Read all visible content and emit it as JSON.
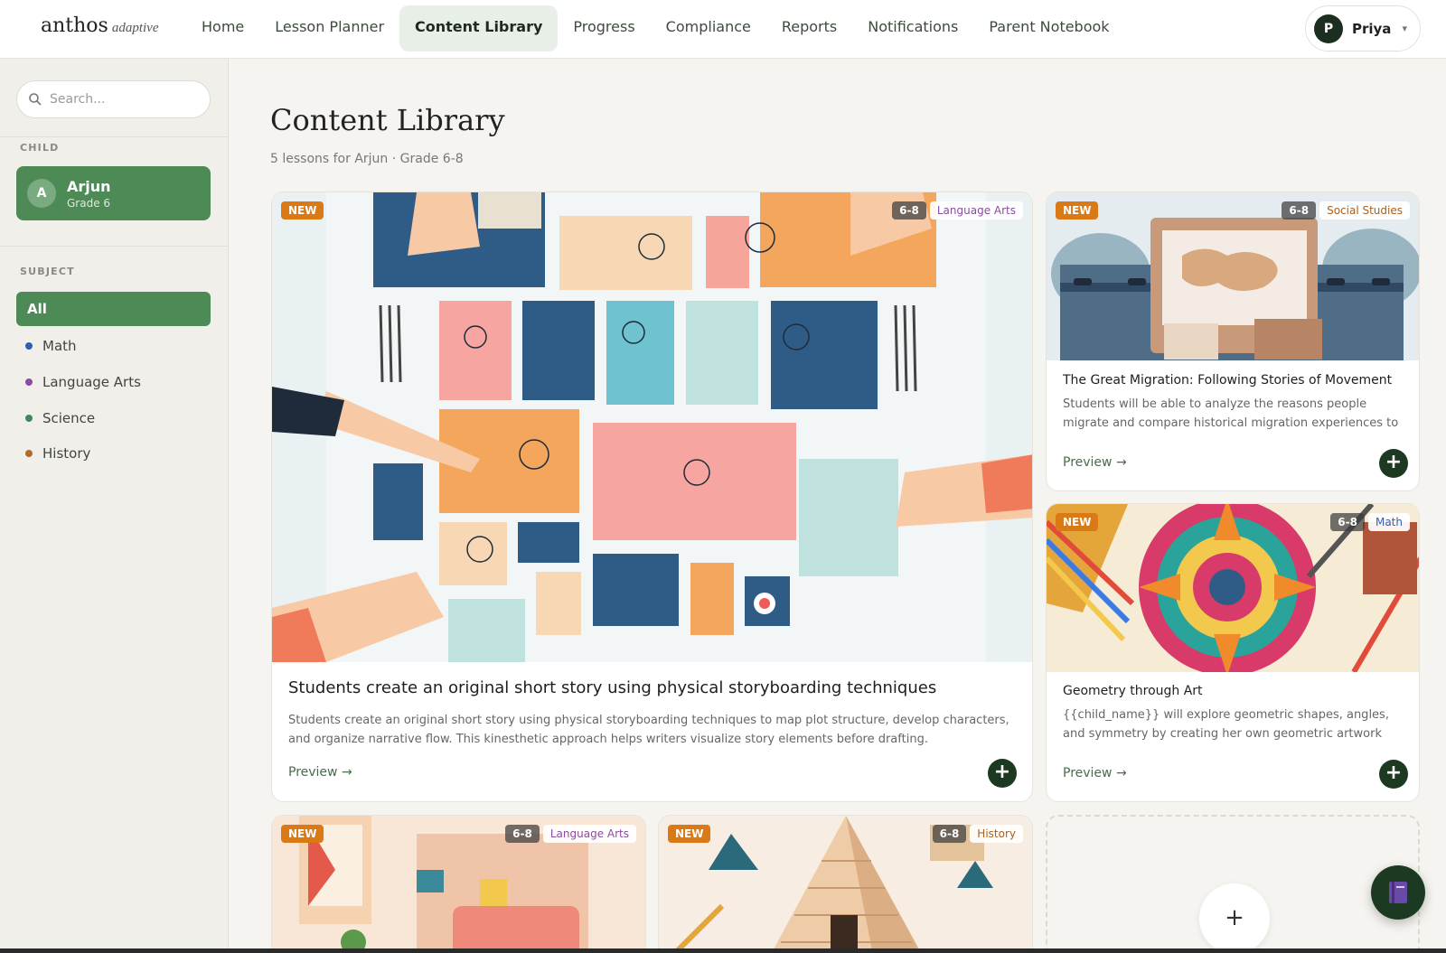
{
  "brand": {
    "name": "anthos",
    "tagline": "adaptive"
  },
  "nav": {
    "items": [
      {
        "label": "Home"
      },
      {
        "label": "Lesson Planner"
      },
      {
        "label": "Content Library",
        "active": true
      },
      {
        "label": "Progress"
      },
      {
        "label": "Compliance"
      },
      {
        "label": "Reports"
      },
      {
        "label": "Notifications"
      },
      {
        "label": "Parent Notebook"
      }
    ]
  },
  "user": {
    "initial": "P",
    "name": "Priya",
    "caret": "▾"
  },
  "sidebar": {
    "search_placeholder": "Search...",
    "child_label": "CHILD",
    "child": {
      "initial": "A",
      "name": "Arjun",
      "grade": "Grade 6"
    },
    "subject_label": "SUBJECT",
    "subjects": [
      {
        "label": "All",
        "active": true
      },
      {
        "label": "Math",
        "color": "#2f5fb3"
      },
      {
        "label": "Language Arts",
        "color": "#8a4c9e"
      },
      {
        "label": "Science",
        "color": "#3f8a5a"
      },
      {
        "label": "History",
        "color": "#b06a2a"
      }
    ]
  },
  "main": {
    "title": "Content Library",
    "subtitle": "5 lessons for Arjun · Grade 6-8",
    "cards": [
      {
        "new": "NEW",
        "grade": "6-8",
        "subject": "Language Arts",
        "subject_color": "#8a4c9e",
        "title": "Students create an original short story using physical storyboarding techniques",
        "desc": "Students create an original short story using physical storyboarding techniques to map plot structure, develop characters, and organize narrative flow. This kinesthetic approach helps writers visualize story elements before drafting.",
        "preview": "Preview →",
        "add": "+"
      },
      {
        "new": "NEW",
        "grade": "6-8",
        "subject": "Social Studies",
        "subject_color": "#a8601f",
        "title": "The Great Migration: Following Stories of Movement",
        "desc": "Students will be able to analyze the reasons people migrate and compare historical migration experiences to modern…",
        "preview": "Preview →",
        "add": "+"
      },
      {
        "new": "NEW",
        "grade": "6-8",
        "subject": "Math",
        "subject_color": "#2f5fb3",
        "title": "Geometry through Art",
        "desc": "{{child_name}} will explore geometric shapes, angles, and symmetry by creating her own geometric artwork inspired…",
        "preview": "Preview →",
        "add": "+"
      },
      {
        "new": "NEW",
        "grade": "6-8",
        "subject": "Language Arts",
        "subject_color": "#8a4c9e"
      },
      {
        "new": "NEW",
        "grade": "6-8",
        "subject": "History",
        "subject_color": "#a8601f"
      }
    ],
    "add_card_icon": "+"
  },
  "icons": {
    "search": "search-icon",
    "fab": "notebook-icon",
    "add": "plus-icon"
  }
}
